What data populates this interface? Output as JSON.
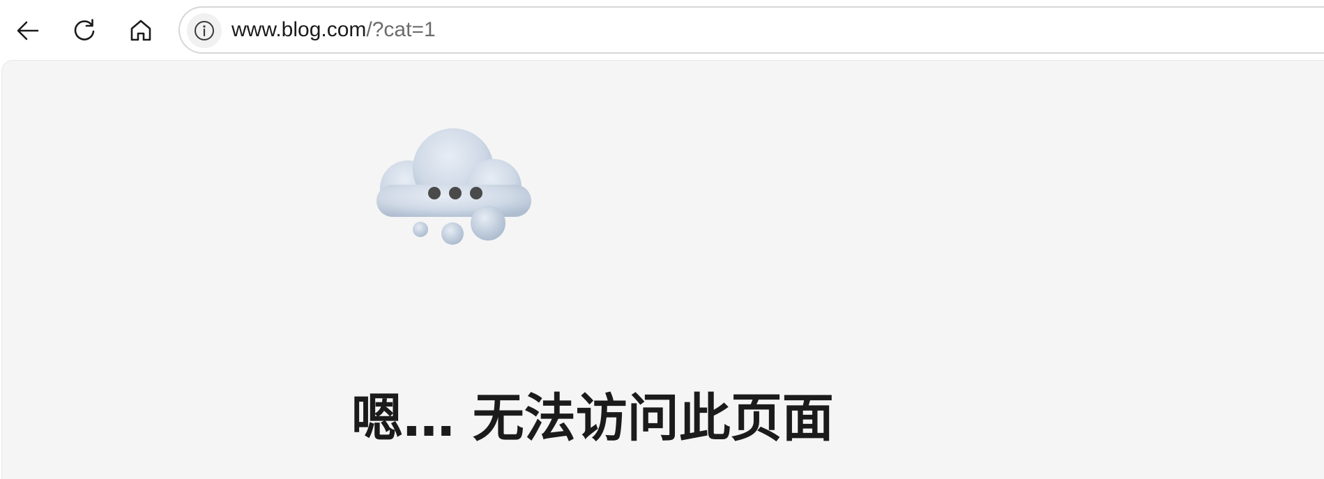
{
  "toolbar": {
    "back_icon": "arrow-left-icon",
    "refresh_icon": "refresh-icon",
    "home_icon": "home-icon"
  },
  "address_bar": {
    "info_icon": "info-icon",
    "url_host": "www.blog.com",
    "url_path": "/?cat=1"
  },
  "page": {
    "illustration_icon": "cloud-icon",
    "title": "嗯… 无法访问此页面"
  },
  "colors": {
    "page_background": "#f5f5f5",
    "toolbar_background": "#ffffff",
    "title_text": "#1b1b1b",
    "url_host_text": "#1a1a1a",
    "url_path_text": "#6b6b6b"
  }
}
